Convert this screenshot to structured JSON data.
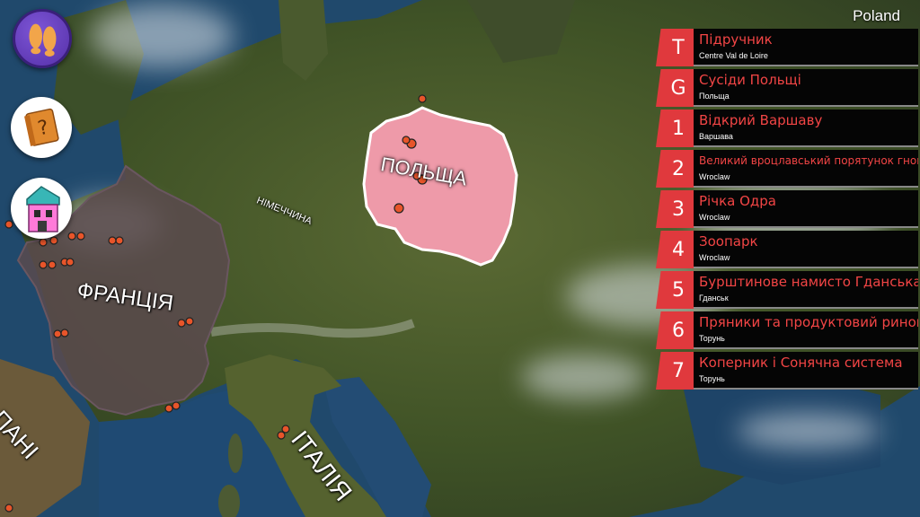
{
  "region_label": "Poland",
  "map_labels": {
    "poland": "ПОЛЬЩА",
    "germany": "НІМЕЧЧИНА",
    "france": "ФРАНЦІЯ",
    "italy": "ІТАЛІЯ",
    "spain": "ПАНІ"
  },
  "side_buttons": {
    "feet": "footprints-icon",
    "book": "question-book-icon",
    "house": "house-icon"
  },
  "tasks": [
    {
      "badge": "T",
      "title": "Підручник",
      "subtitle": "Centre Val de Loire"
    },
    {
      "badge": "G",
      "title": "Сусіди Польщі",
      "subtitle": "Польща"
    },
    {
      "badge": "1",
      "title": "Відкрий Варшаву",
      "subtitle": "Варшава"
    },
    {
      "badge": "2",
      "title": "Великий вроцлавський порятунок гномів",
      "subtitle": "Wroclaw"
    },
    {
      "badge": "3",
      "title": "Річка Одра",
      "subtitle": "Wroclaw"
    },
    {
      "badge": "4",
      "title": "Зоопарк",
      "subtitle": "Wroclaw"
    },
    {
      "badge": "5",
      "title": "Бурштинове намисто Гданська",
      "subtitle": "Гданськ"
    },
    {
      "badge": "6",
      "title": "Пряники та продуктовий ринок",
      "subtitle": "Торунь"
    },
    {
      "badge": "7",
      "title": "Коперник і Сонячна система",
      "subtitle": "Торунь"
    }
  ],
  "colors": {
    "accent": "#e0393d",
    "task_title": "#f24545",
    "poland_fill": "#ee9aa9",
    "france_fill": "#5a4a4d"
  }
}
